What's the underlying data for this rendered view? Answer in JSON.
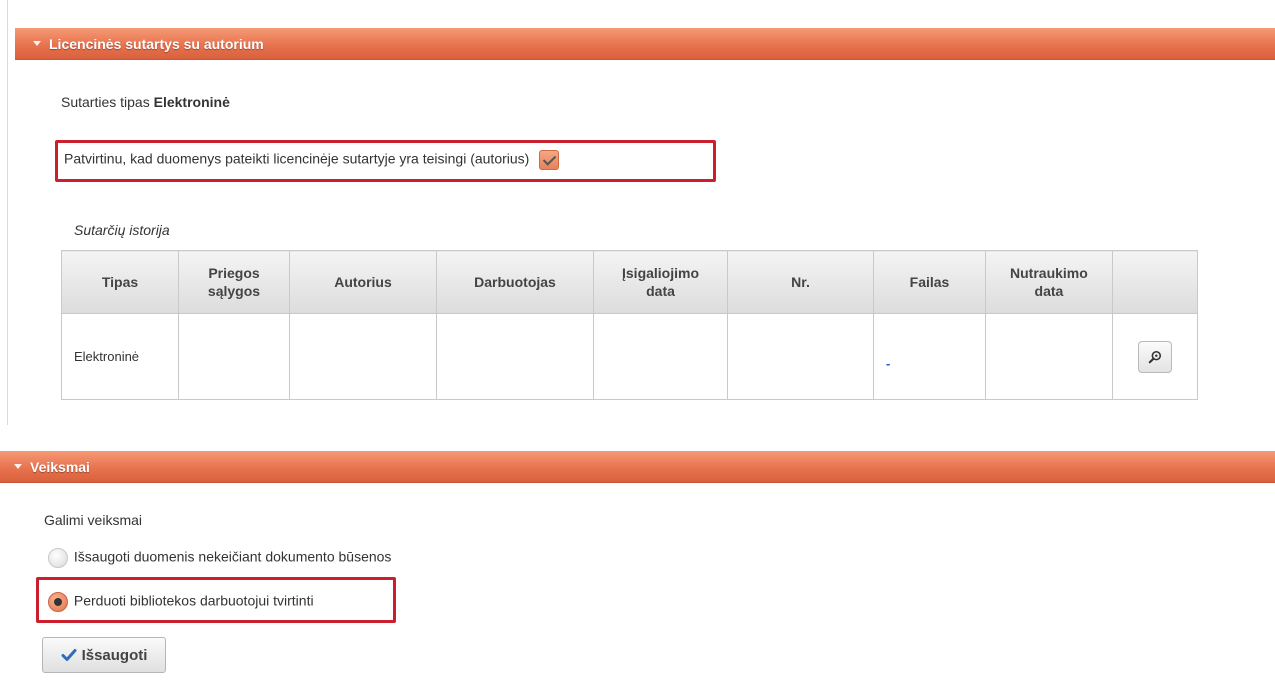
{
  "license_section": {
    "title": "Licencinės sutartys su autorium",
    "contract_type_label": "Sutarties tipas",
    "contract_type_value": "Elektroninė",
    "confirm_text": "Patvirtinu, kad duomenys pateikti licencinėje sutartyje yra teisingi (autorius)",
    "confirm_checked": true,
    "history_title": "Sutarčių istorija",
    "table": {
      "headers": [
        "Tipas",
        "Priegos sąlygos",
        "Autorius",
        "Darbuotojas",
        "Įsigaliojimo data",
        "Nr.",
        "Failas",
        "Nutraukimo data",
        ""
      ],
      "rows": [
        {
          "tipas": "Elektroninė",
          "priegos": "",
          "autorius": "",
          "darbuotojas": "",
          "isigaliojimo": "",
          "nr": "",
          "failas": "-",
          "nutraukimo": "",
          "action_icon": "magnifier-icon"
        }
      ]
    }
  },
  "actions_section": {
    "title": "Veiksmai",
    "subtitle": "Galimi veiksmai",
    "options": [
      {
        "label": "Išsaugoti duomenis nekeičiant dokumento būsenos",
        "selected": false
      },
      {
        "label": "Perduoti bibliotekos darbuotojui tvirtinti",
        "selected": true
      }
    ],
    "save_label": "Išsaugoti",
    "save_icon": "checkmark-icon"
  },
  "colors": {
    "header_orange": "#e8734f",
    "highlight_red": "#cc1f2d",
    "link_blue": "#1a5fd0"
  }
}
